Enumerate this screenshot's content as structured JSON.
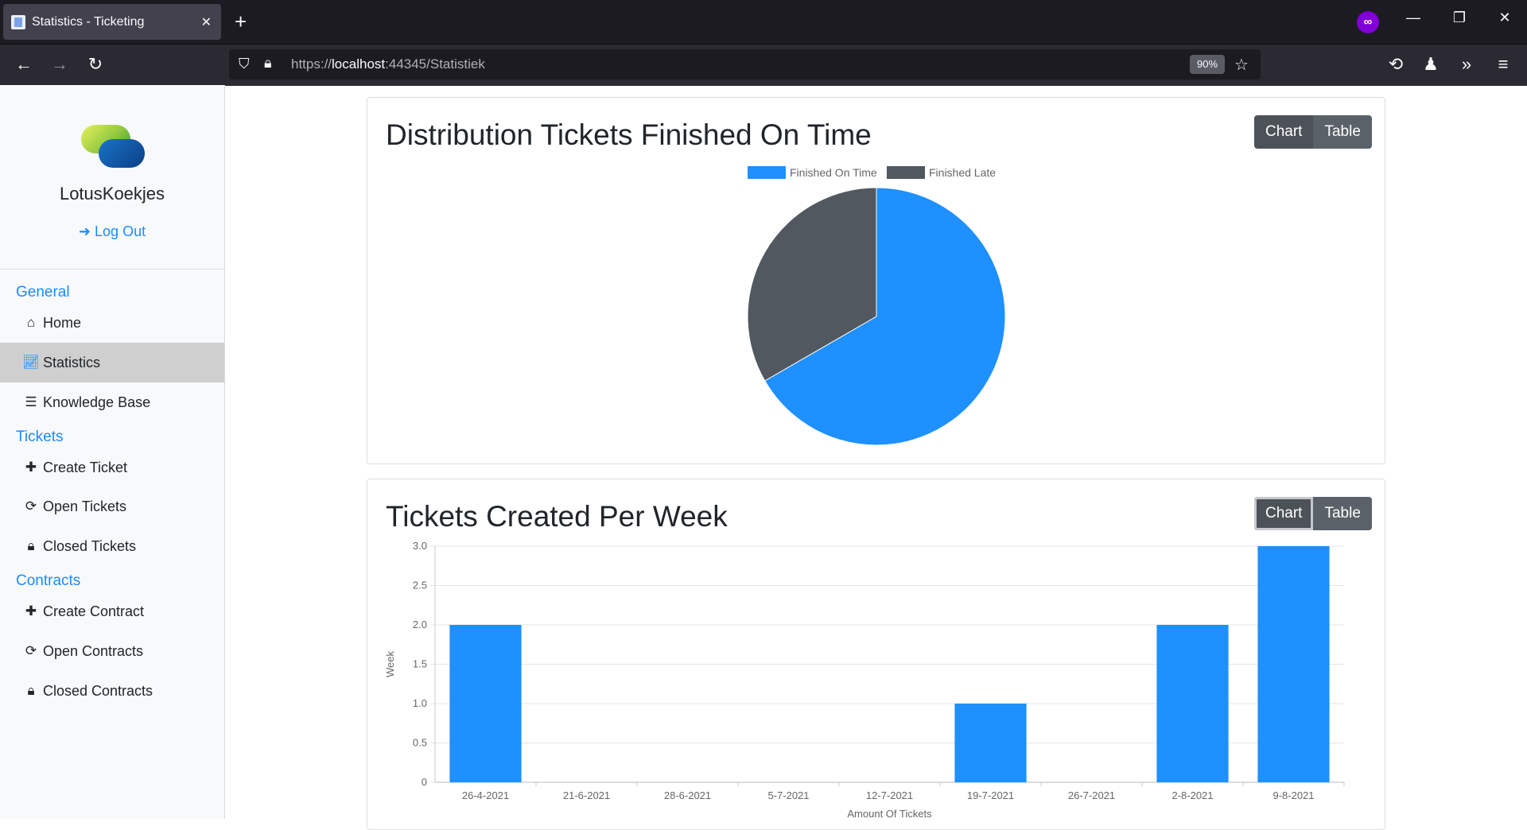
{
  "browser": {
    "tab_title": "Statistics - Ticketing",
    "url_scheme": "https://",
    "url_host": "localhost",
    "url_rest": ":44345/Statistiek",
    "zoom": "90%"
  },
  "sidebar": {
    "brand": "LotusKoekjes",
    "logout": "Log Out",
    "sections": {
      "general": "General",
      "tickets": "Tickets",
      "contracts": "Contracts"
    },
    "items": {
      "home": "Home",
      "statistics": "Statistics",
      "knowledge_base": "Knowledge Base",
      "create_ticket": "Create Ticket",
      "open_tickets": "Open Tickets",
      "closed_tickets": "Closed Tickets",
      "create_contract": "Create Contract",
      "open_contracts": "Open Contracts",
      "closed_contracts": "Closed Contracts"
    }
  },
  "toggle": {
    "chart": "Chart",
    "table": "Table"
  },
  "colors": {
    "primary": "#1e90ff",
    "dark": "#525860",
    "link": "#1a8cff"
  },
  "chart_data": [
    {
      "type": "pie",
      "title": "Distribution Tickets Finished On Time",
      "labels": [
        "Finished On Time",
        "Finished Late"
      ],
      "values": [
        6,
        3
      ],
      "colors": [
        "#1e90ff",
        "#525860"
      ],
      "legend": "top"
    },
    {
      "type": "bar",
      "title": "Tickets Created Per Week",
      "categories": [
        "26-4-2021",
        "21-6-2021",
        "28-6-2021",
        "5-7-2021",
        "12-7-2021",
        "19-7-2021",
        "26-7-2021",
        "2-8-2021",
        "9-8-2021"
      ],
      "values": [
        2,
        0,
        0,
        0,
        0,
        1,
        0,
        2,
        3
      ],
      "xlabel": "Amount Of Tickets",
      "ylabel": "Week",
      "ylim": [
        0,
        3
      ],
      "yticks": [
        "0",
        "0.5",
        "1.0",
        "1.5",
        "2.0",
        "2.5",
        "3.0"
      ],
      "grid": true,
      "color": "#1e90ff"
    }
  ]
}
